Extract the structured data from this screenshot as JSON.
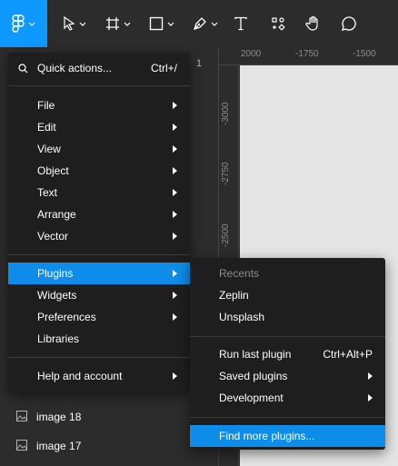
{
  "toolbar": {
    "tools": [
      {
        "name": "main-menu",
        "icon": "figma-logo-icon",
        "active": true
      },
      {
        "name": "move",
        "icon": "move-cursor-icon"
      },
      {
        "name": "frame",
        "icon": "frame-icon"
      },
      {
        "name": "shape",
        "icon": "rectangle-icon"
      },
      {
        "name": "pen",
        "icon": "pen-icon"
      },
      {
        "name": "text",
        "icon": "text-icon",
        "label": "T"
      },
      {
        "name": "resources",
        "icon": "resources-icon"
      },
      {
        "name": "hand",
        "icon": "hand-icon"
      },
      {
        "name": "comment",
        "icon": "comment-icon"
      }
    ],
    "accent": "#0d99ff"
  },
  "left_panel": {
    "zoom_fragment": "1",
    "layers": [
      {
        "label": "image 18",
        "icon": "image-icon"
      },
      {
        "label": "image 17",
        "icon": "image-icon"
      }
    ]
  },
  "rulers": {
    "top_ticks": [
      "2000",
      "-1750",
      "-1500"
    ],
    "left_ticks": [
      "-3000",
      "-2750",
      "-2500"
    ]
  },
  "main_menu": {
    "quick_actions": {
      "label": "Quick actions...",
      "shortcut": "Ctrl+/",
      "icon": "search-icon"
    },
    "group1": [
      {
        "label": "File",
        "submenu": true
      },
      {
        "label": "Edit",
        "submenu": true
      },
      {
        "label": "View",
        "submenu": true
      },
      {
        "label": "Object",
        "submenu": true
      },
      {
        "label": "Text",
        "submenu": true
      },
      {
        "label": "Arrange",
        "submenu": true
      },
      {
        "label": "Vector",
        "submenu": true
      }
    ],
    "group2": [
      {
        "label": "Plugins",
        "submenu": true,
        "active": true
      },
      {
        "label": "Widgets",
        "submenu": true
      },
      {
        "label": "Preferences",
        "submenu": true
      },
      {
        "label": "Libraries",
        "submenu": false
      }
    ],
    "group3": [
      {
        "label": "Help and account",
        "submenu": true
      }
    ]
  },
  "plugins_menu": {
    "recents_heading": "Recents",
    "recents": [
      {
        "label": "Zeplin"
      },
      {
        "label": "Unsplash"
      }
    ],
    "actions": [
      {
        "label": "Run last plugin",
        "shortcut": "Ctrl+Alt+P",
        "submenu": false
      },
      {
        "label": "Saved plugins",
        "submenu": true
      },
      {
        "label": "Development",
        "submenu": true
      }
    ],
    "find_more": {
      "label": "Find more plugins...",
      "active": true
    }
  },
  "colors": {
    "menu_bg": "#1e1e1e",
    "highlight": "#0d8de9",
    "toolbar_bg": "#2c2c2c",
    "canvas_bg": "#e5e5e5"
  }
}
